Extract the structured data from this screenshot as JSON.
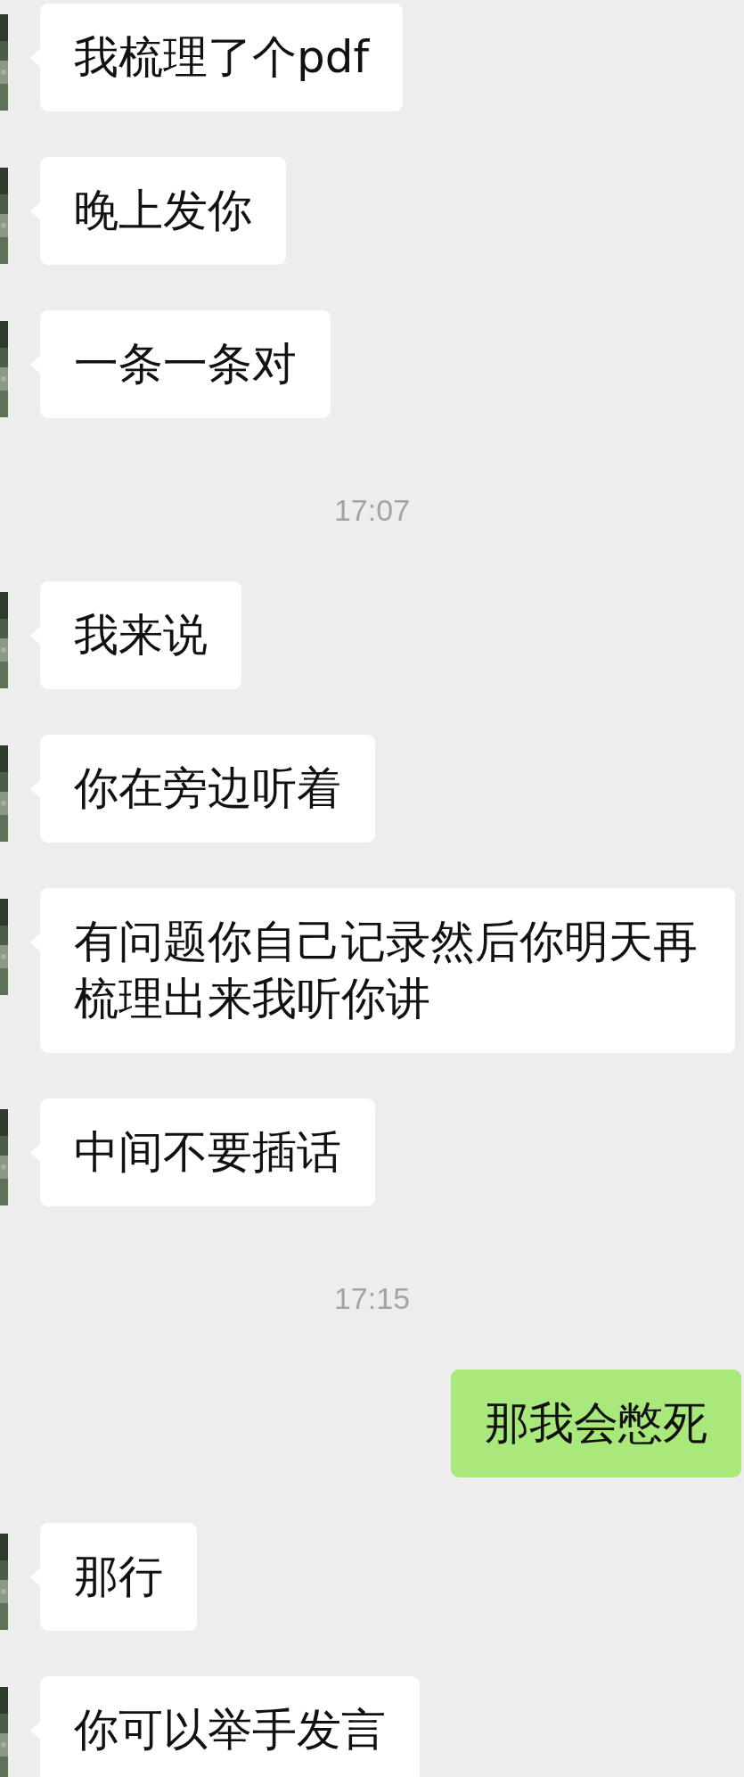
{
  "messages": [
    {
      "kind": "received",
      "text": "我梳理了个pdf"
    },
    {
      "kind": "received",
      "text": "晚上发你"
    },
    {
      "kind": "received",
      "text": "一条一条对"
    },
    {
      "kind": "time",
      "text": "17:07"
    },
    {
      "kind": "received",
      "text": "我来说"
    },
    {
      "kind": "received",
      "text": "你在旁边听着"
    },
    {
      "kind": "received",
      "text": "有问题你自己记录然后你明天再梳理出来我听你讲"
    },
    {
      "kind": "received",
      "text": "中间不要插话"
    },
    {
      "kind": "time",
      "text": "17:15"
    },
    {
      "kind": "sent",
      "text": "那我会憋死"
    },
    {
      "kind": "received",
      "text": "那行"
    },
    {
      "kind": "received",
      "text": "你可以举手发言"
    }
  ]
}
